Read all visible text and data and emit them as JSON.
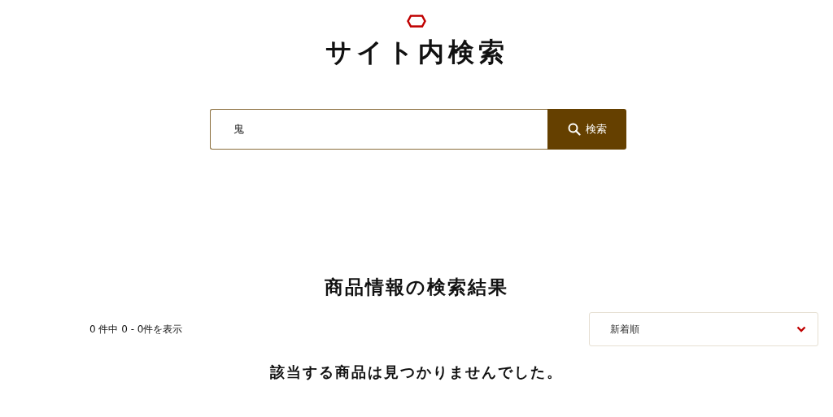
{
  "title": "サイト内検索",
  "search": {
    "value": "鬼",
    "button": "検索"
  },
  "results": {
    "heading": "商品情報の検索結果",
    "count": "0 件中 0 - 0件を表示",
    "sort": "新着順",
    "message": "該当する商品は見つかりませんでした。"
  }
}
